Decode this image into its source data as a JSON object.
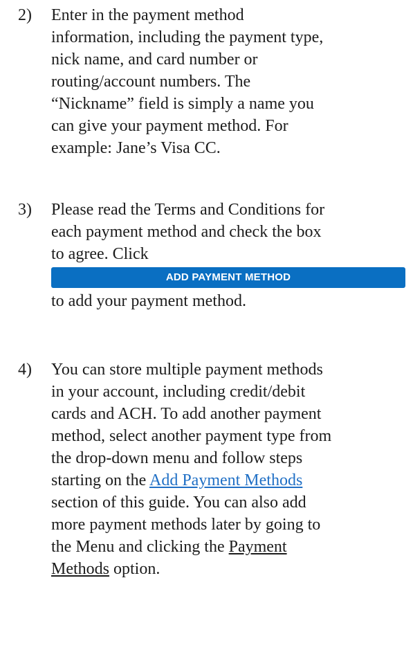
{
  "steps": [
    {
      "number": "2)",
      "lines": [
        "Enter in the payment method",
        "information, including the payment type,",
        "nick name, and card number or",
        "routing/account numbers.  The",
        "“Nickname” field is simply a name you",
        "can give your payment method.  For",
        "example: Jane’s Visa CC."
      ]
    },
    {
      "number": "3)",
      "lines": [
        "Please read the Terms and Conditions for",
        "each payment method and check the box",
        "to agree.  Click"
      ],
      "button_label": "ADD PAYMENT METHOD",
      "after_button": "to add your payment method."
    },
    {
      "number": "4)",
      "lines": [
        "You can store multiple payment methods",
        "in your account, including credit/debit",
        "cards and ACH.  To add another payment",
        "method, select another payment type from",
        "the drop-down menu and follow steps"
      ],
      "link_prefix": "starting on the ",
      "link_text": "Add Payment Methods",
      "after_link_lines": [
        "section of this guide.  You can also add",
        "more payment methods later by going to"
      ],
      "menu_prefix": "the Menu and clicking the ",
      "menu_link_part1": "Payment",
      "menu_link_part2": "Methods",
      "menu_suffix": " option."
    }
  ]
}
